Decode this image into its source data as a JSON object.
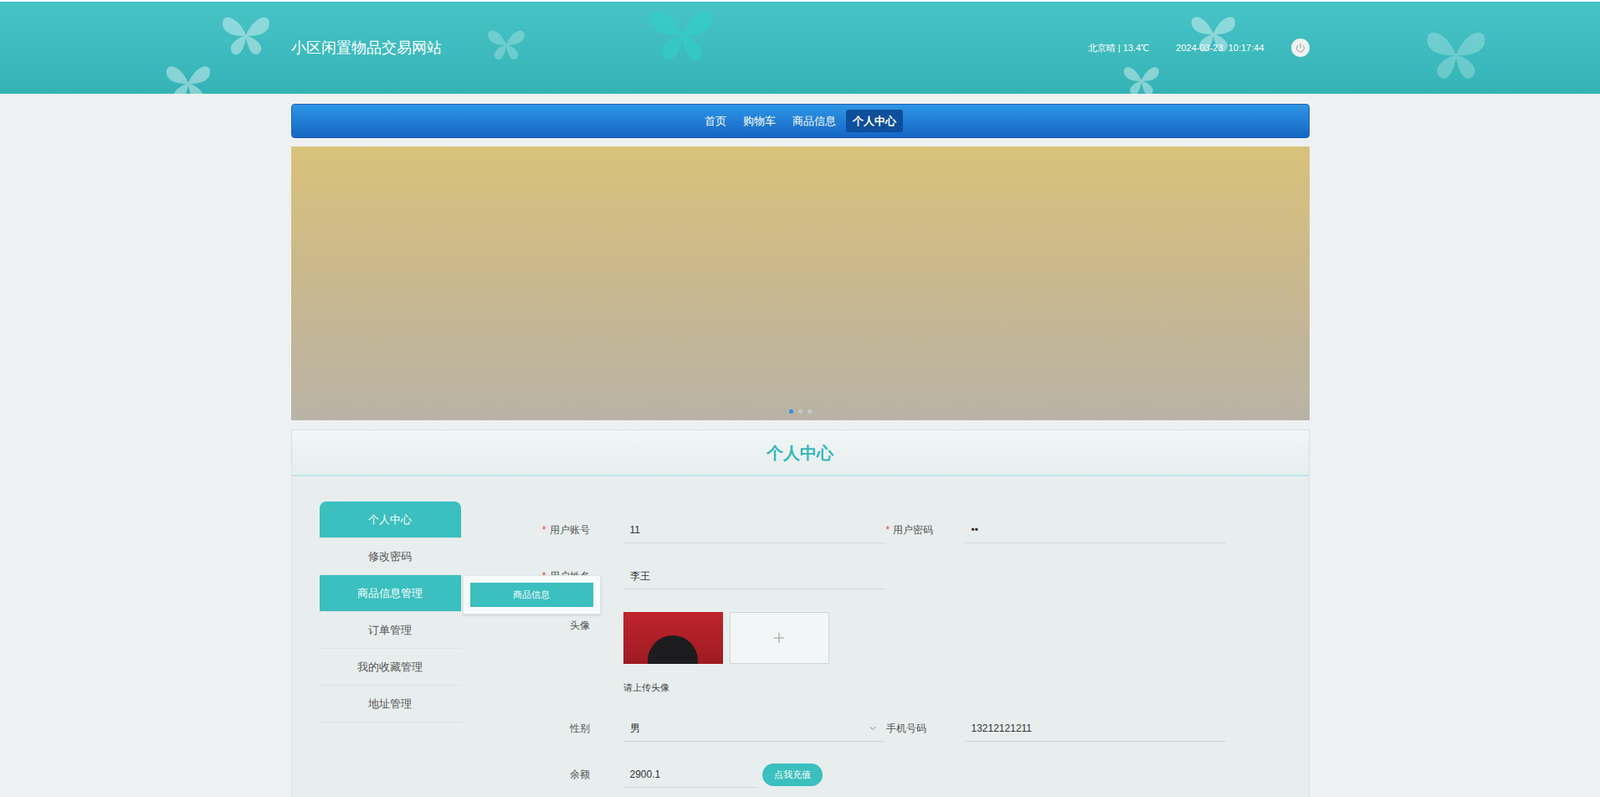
{
  "site": {
    "title": "小区闲置物品交易网站",
    "weather": "北京晴 | 13.4℃",
    "datetime": "2024-03-23  10:17:44"
  },
  "nav": [
    {
      "label": "首页",
      "selected": false
    },
    {
      "label": "购物车",
      "selected": false
    },
    {
      "label": "商品信息",
      "selected": false
    },
    {
      "label": "个人中心",
      "selected": true
    }
  ],
  "banner": {
    "dots": [
      {
        "selected": true
      },
      {
        "selected": false
      },
      {
        "selected": false
      }
    ]
  },
  "panel": {
    "title": "个人中心"
  },
  "sidebar": [
    {
      "label": "个人中心",
      "selected": true,
      "expanded": false,
      "submenu": []
    },
    {
      "label": "修改密码",
      "selected": false,
      "expanded": false,
      "submenu": []
    },
    {
      "label": "商品信息管理",
      "selected": false,
      "expanded": true,
      "submenu": [
        "商品信息"
      ]
    },
    {
      "label": "订单管理",
      "selected": false,
      "expanded": false,
      "submenu": []
    },
    {
      "label": "我的收藏管理",
      "selected": false,
      "expanded": false,
      "submenu": []
    },
    {
      "label": "地址管理",
      "selected": false,
      "expanded": false,
      "submenu": []
    }
  ],
  "form": {
    "required_mark": "*",
    "rows": [
      [
        {
          "label": "用户账号",
          "required": true,
          "kind": "text",
          "value": "11"
        },
        {
          "label": "用户密码",
          "required": true,
          "kind": "text",
          "value": "••"
        }
      ],
      [
        {
          "label": "用户姓名",
          "required": true,
          "kind": "text",
          "value": "李王"
        }
      ],
      [
        {
          "label": "头像",
          "required": false,
          "kind": "image",
          "hint": "请上传头像"
        }
      ],
      [
        {
          "label": "性别",
          "required": false,
          "kind": "select",
          "value": "男"
        },
        {
          "label": "手机号码",
          "required": false,
          "kind": "text",
          "value": "13212121211"
        }
      ],
      [
        {
          "label": "余额",
          "required": false,
          "kind": "recharge",
          "value": "2900.1",
          "button": "点我充值"
        }
      ]
    ]
  }
}
